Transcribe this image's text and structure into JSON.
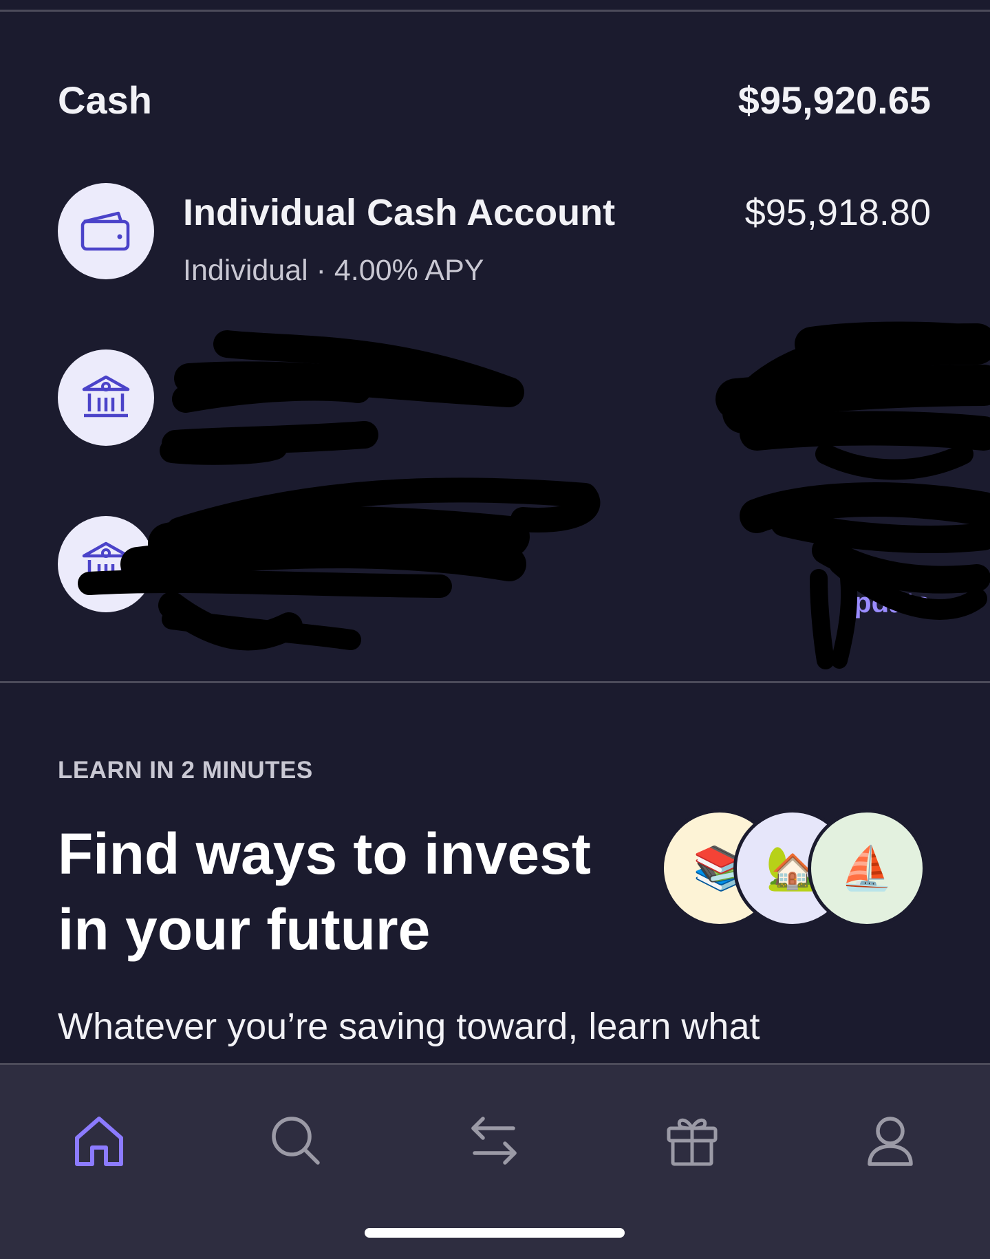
{
  "cash_section": {
    "title": "Cash",
    "total": "$95,920.65"
  },
  "accounts": [
    {
      "name": "Individual Cash Account",
      "subtitle": "Individual · 4.00% APY",
      "amount": "$95,918.80",
      "icon": "wallet-icon"
    },
    {
      "name": "",
      "subtitle": "",
      "amount": "",
      "icon": "bank-icon"
    },
    {
      "name": "",
      "subtitle": "",
      "link": "pdate",
      "icon": "bank-icon"
    }
  ],
  "learn": {
    "eyebrow": "LEARN IN 2 MINUTES",
    "title": "Find ways to invest in your future",
    "body": "Whatever you’re saving toward, learn what",
    "bubbles": [
      {
        "emoji": "📚",
        "bg": "#fdf3d6"
      },
      {
        "emoji": "🏡",
        "bg": "#e6e6fa"
      },
      {
        "emoji": "⛵",
        "bg": "#e3f1df"
      }
    ]
  },
  "tabbar": {
    "tabs": [
      "home-icon",
      "search-icon",
      "transfer-icon",
      "gift-icon",
      "profile-icon"
    ],
    "active": "home-icon"
  },
  "colors": {
    "background": "#1b1b2e",
    "accent": "#8c7bff",
    "icon_bg": "#ecebfb",
    "icon_stroke": "#4b43c9"
  }
}
